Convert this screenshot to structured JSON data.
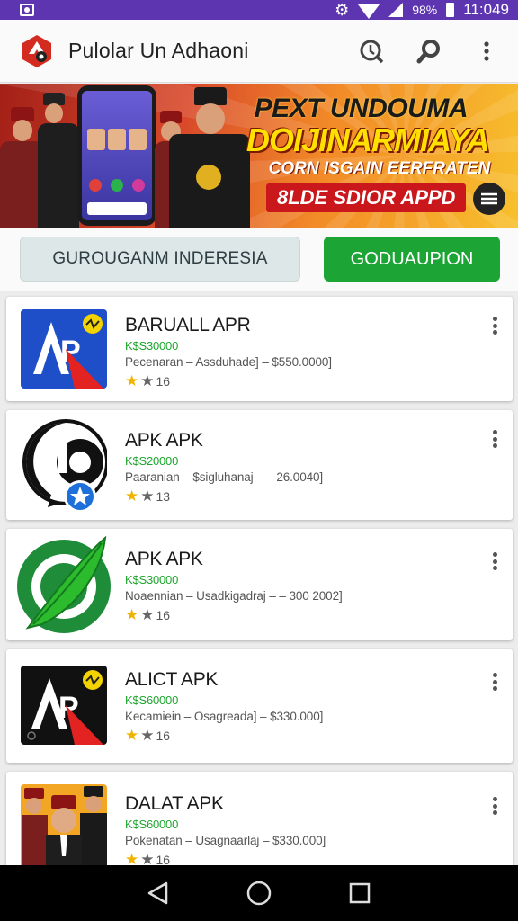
{
  "status_bar": {
    "battery": "98%",
    "time": "11:049"
  },
  "app_bar": {
    "title": "Pulolar Un Adhaoni",
    "icons": [
      "app-logo-icon",
      "download-history-icon",
      "search-icon",
      "more-vert-icon"
    ]
  },
  "banner": {
    "line1": "PEXT UNDOUMA",
    "line2": "DOIJINARMIAYA",
    "line3": "CORN ISGAIN EERFRATEN",
    "line4": "8LDE SDIOR APPD",
    "colors": {
      "start": "#a32018",
      "end": "#f7c02d",
      "headline": "#ffe000"
    }
  },
  "actions": {
    "secondary_label": "GUROUGANM INDERESIA",
    "primary_label": "GODUAUPION",
    "primary_color": "#1ca534"
  },
  "apps": [
    {
      "name": "BARUALL APR",
      "price": "K$S30000",
      "desc": "Pecenaran – Assduhade] – $550.0000]",
      "rating": "16",
      "icon": "ap-blue-red-icon"
    },
    {
      "name": "APK APK",
      "price": "K$S20000",
      "desc": "Paaranian – $sigluhanaj – – 26.0040]",
      "rating": "13",
      "icon": "black-speech-bubble-icon"
    },
    {
      "name": "APK APK",
      "price": "K$S30000",
      "desc": "Noaennian – Usadkigadraj – – 300 2002]",
      "rating": "16",
      "icon": "green-leaf-circle-icon"
    },
    {
      "name": "ALICT APK",
      "price": "K$S60000",
      "desc": "Kecamiein – Osagreada] – $330.000]",
      "rating": "16",
      "icon": "ap-black-red-icon"
    },
    {
      "name": "DALAT APK",
      "price": "K$S60000",
      "desc": "Pokenatan – Usagnaarlaj – $330.000]",
      "rating": "16",
      "icon": "uniformed-men-photo-icon"
    }
  ],
  "nav": {
    "icons": [
      "back-icon",
      "home-icon",
      "recents-icon"
    ]
  }
}
